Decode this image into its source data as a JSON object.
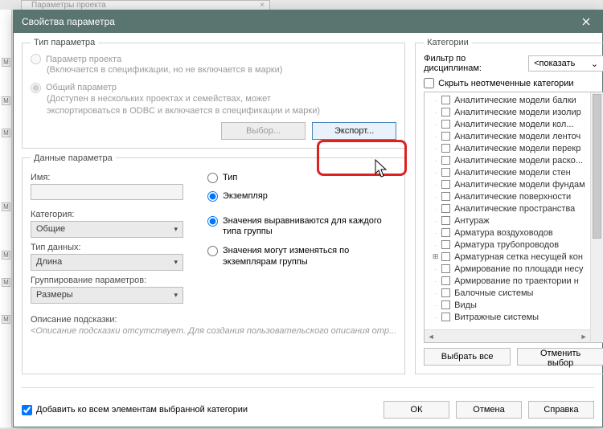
{
  "backdrop": {
    "tab": "Параметры проекта"
  },
  "title": "Свойства параметра",
  "left": {
    "type_group": "Тип параметра",
    "proj_param": "Параметр проекта",
    "proj_sub": "(Включается в спецификации, но не включается в марки)",
    "shared_param": "Общий параметр",
    "shared_sub1": "(Доступен в нескольких проектах и семействах, может",
    "shared_sub2": "экспортироваться в ODBC и включается в спецификации и марки)",
    "select_btn": "Выбор...",
    "export_btn": "Экспорт...",
    "data_group": "Данные параметра",
    "name_lbl": "Имя:",
    "name_val": "",
    "cat_lbl": "Категория:",
    "cat_val": "Общие",
    "type_lbl": "Тип данных:",
    "type_val": "Длина",
    "group_lbl": "Группирование параметров:",
    "group_val": "Размеры",
    "r_type": "Тип",
    "r_inst": "Экземпляр",
    "r_align": "Значения выравниваются для каждого типа группы",
    "r_vary": "Значения могут изменяться по экземплярам группы",
    "hint_lbl": "Описание подсказки:",
    "hint_val": "<Описание подсказки отсутствует. Для создания пользовательского описания отр..."
  },
  "right": {
    "cat_group": "Категории",
    "filter_lbl": "Фильтр по дисциплинам:",
    "filter_val": "<показать",
    "hide_unchecked": "Скрыть неотмеченные категории",
    "items": [
      "Аналитические модели балки",
      "Аналитические модели изолир",
      "Аналитические модели кол...",
      "Аналитические модели ленточ",
      "Аналитические модели перекр",
      "Аналитические модели раско...",
      "Аналитические модели стен",
      "Аналитические модели фундам",
      "Аналитические поверхности",
      "Аналитические пространства",
      "Антураж",
      "Арматура воздуховодов",
      "Арматура трубопроводов",
      "Арматурная сетка несущей кон",
      "Армирование по площади несу",
      "Армирование по траектории н",
      "Балочные системы",
      "Виды",
      "Витражные системы"
    ],
    "expander_row": 13,
    "select_all": "Выбрать все",
    "deselect_all": "Отменить выбор"
  },
  "bottom": {
    "add_all": "Добавить ко всем элементам выбранной категории",
    "ok": "ОК",
    "cancel": "Отмена",
    "help": "Справка"
  }
}
